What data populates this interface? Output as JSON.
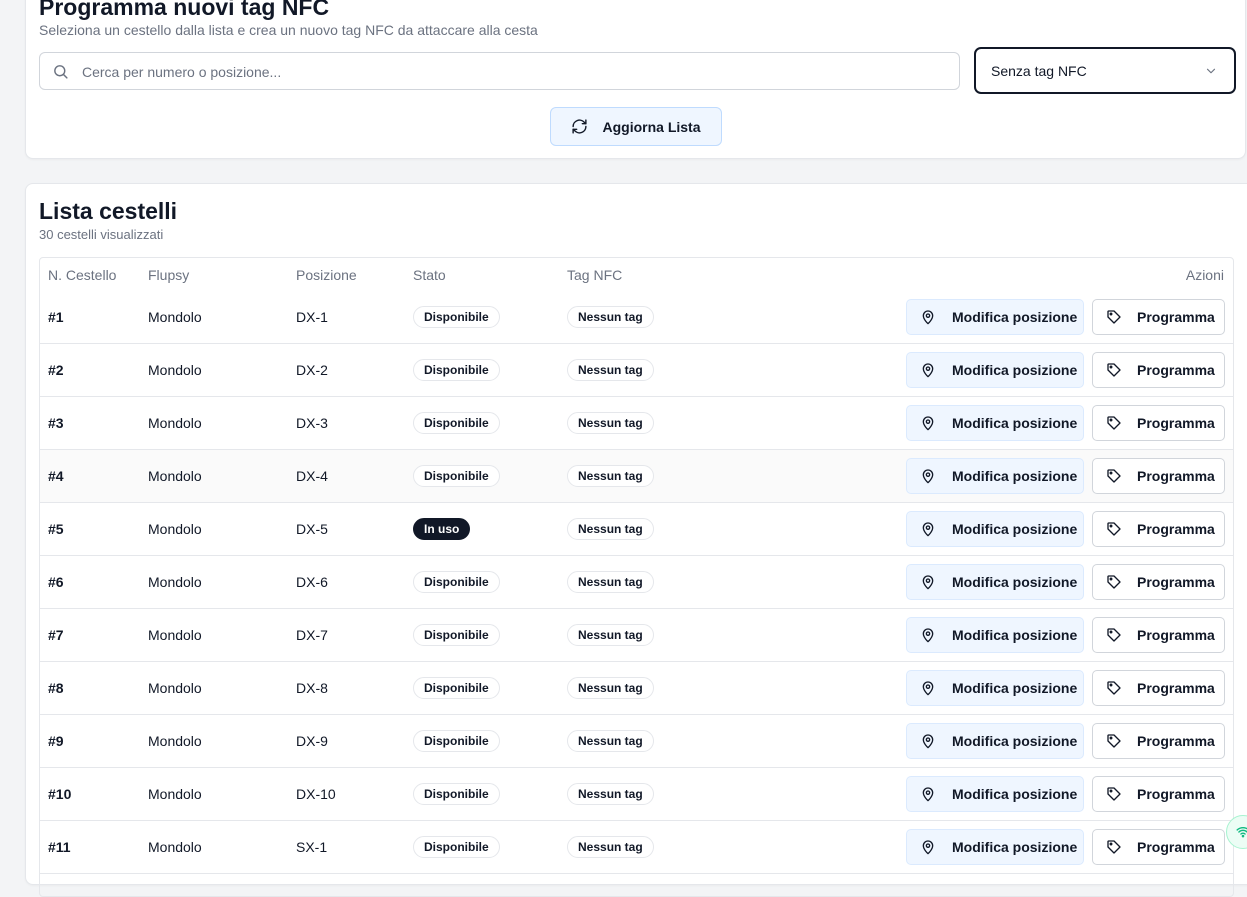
{
  "header": {
    "title": "Programma nuovi tag NFC",
    "subtitle": "Seleziona un cestello dalla lista e crea un nuovo tag NFC da attaccare alla cesta"
  },
  "search": {
    "placeholder": "Cerca per numero o posizione...",
    "value": ""
  },
  "filter": {
    "selected": "Senza tag NFC"
  },
  "refresh_button": {
    "label": "Aggiorna Lista"
  },
  "list": {
    "title": "Lista cestelli",
    "subtitle": "30 cestelli visualizzati",
    "columns": [
      "N. Cestello",
      "Flupsy",
      "Posizione",
      "Stato",
      "Tag NFC",
      "Azioni"
    ],
    "actions": {
      "modify_label": "Modifica posizione",
      "program_label": "Programma"
    },
    "rows": [
      {
        "num": "#1",
        "flupsy": "Mondolo",
        "pos": "DX-1",
        "stato": "Disponibile",
        "tag": "Nessun tag"
      },
      {
        "num": "#2",
        "flupsy": "Mondolo",
        "pos": "DX-2",
        "stato": "Disponibile",
        "tag": "Nessun tag"
      },
      {
        "num": "#3",
        "flupsy": "Mondolo",
        "pos": "DX-3",
        "stato": "Disponibile",
        "tag": "Nessun tag"
      },
      {
        "num": "#4",
        "flupsy": "Mondolo",
        "pos": "DX-4",
        "stato": "Disponibile",
        "tag": "Nessun tag"
      },
      {
        "num": "#5",
        "flupsy": "Mondolo",
        "pos": "DX-5",
        "stato": "In uso",
        "tag": "Nessun tag"
      },
      {
        "num": "#6",
        "flupsy": "Mondolo",
        "pos": "DX-6",
        "stato": "Disponibile",
        "tag": "Nessun tag"
      },
      {
        "num": "#7",
        "flupsy": "Mondolo",
        "pos": "DX-7",
        "stato": "Disponibile",
        "tag": "Nessun tag"
      },
      {
        "num": "#8",
        "flupsy": "Mondolo",
        "pos": "DX-8",
        "stato": "Disponibile",
        "tag": "Nessun tag"
      },
      {
        "num": "#9",
        "flupsy": "Mondolo",
        "pos": "DX-9",
        "stato": "Disponibile",
        "tag": "Nessun tag"
      },
      {
        "num": "#10",
        "flupsy": "Mondolo",
        "pos": "DX-10",
        "stato": "Disponibile",
        "tag": "Nessun tag"
      },
      {
        "num": "#11",
        "flupsy": "Mondolo",
        "pos": "SX-1",
        "stato": "Disponibile",
        "tag": "Nessun tag"
      }
    ]
  },
  "colors": {
    "accent_bg": "#eff6ff",
    "dark_badge": "#111827",
    "muted_text": "#6b7280"
  }
}
